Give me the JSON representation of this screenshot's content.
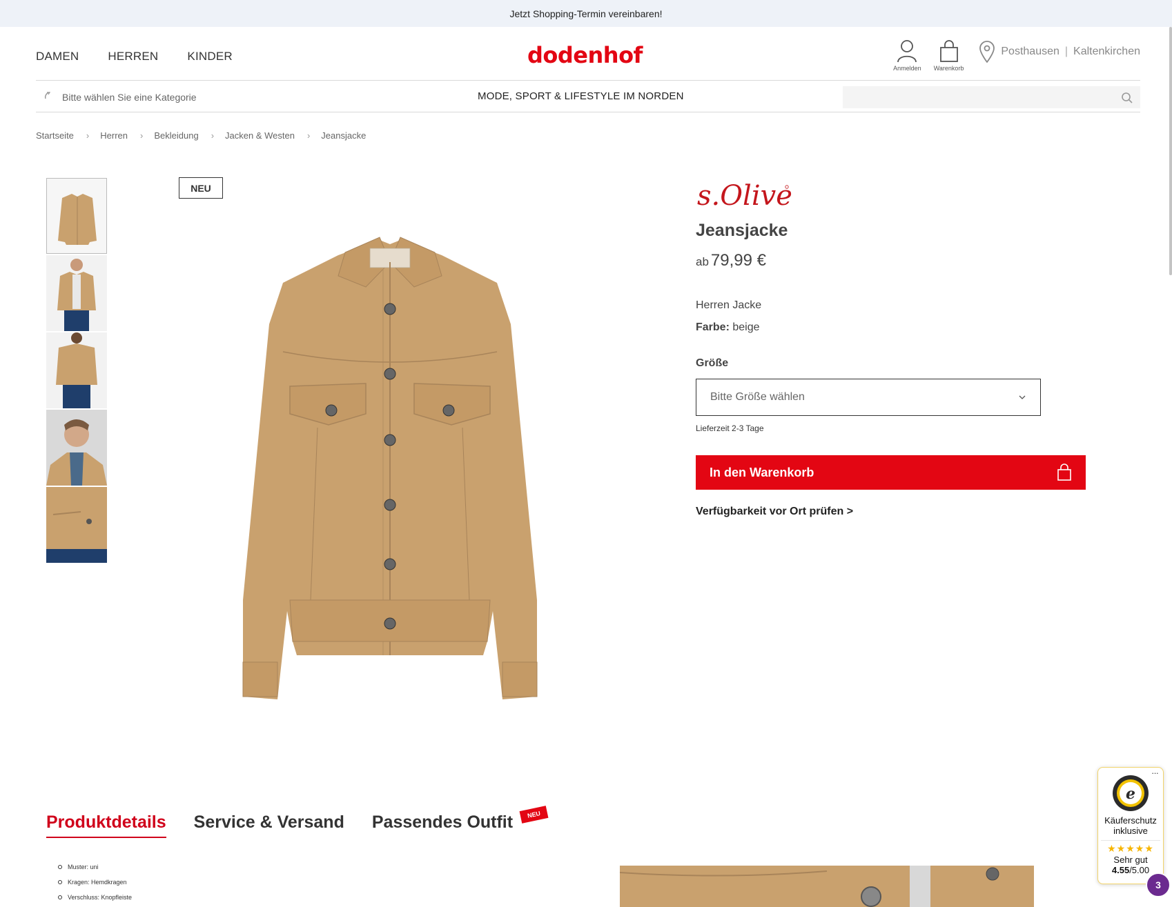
{
  "topbar": {
    "text": "Jetzt Shopping-Termin vereinbaren!"
  },
  "header": {
    "nav": [
      "DAMEN",
      "HERREN",
      "KINDER"
    ],
    "logo": "dodenhof",
    "login_label": "Anmelden",
    "cart_label": "Warenkorb",
    "store_1": "Posthausen",
    "store_2": "Kaltenkirchen"
  },
  "subbar": {
    "category_placeholder": "Bitte wählen Sie eine Kategorie",
    "slogan": "MODE, SPORT & LIFESTYLE IM NORDEN",
    "search_placeholder": ""
  },
  "breadcrumb": [
    "Startseite",
    "Herren",
    "Bekleidung",
    "Jacken & Westen",
    "Jeansjacke"
  ],
  "product": {
    "badge": "NEU",
    "brand": "s.Oliver",
    "name": "Jeansjacke",
    "price_prefix": "ab",
    "price": "79,99 €",
    "description": "Herren Jacke",
    "color_label": "Farbe:",
    "color_value": "beige",
    "size_label": "Größe",
    "size_placeholder": "Bitte Größe wählen",
    "delivery": "Lieferzeit 2-3 Tage",
    "cart_button": "In den Warenkorb",
    "availability": "Verfügbarkeit vor Ort prüfen >"
  },
  "tabs": {
    "details": "Produktdetails",
    "service": "Service & Versand",
    "outfit": "Passendes Outfit",
    "outfit_flag": "NEU"
  },
  "details_list": [
    "Muster: uni",
    "Kragen: Hemdkragen",
    "Verschluss: Knopfleiste"
  ],
  "trusted": {
    "line1": "Käuferschutz",
    "line2": "inklusive",
    "stars": "★★★★★",
    "grade": "Sehr gut",
    "score": "4.55",
    "score_max": "/5.00"
  },
  "notification_count": "3",
  "colors": {
    "brand_red": "#e30613",
    "tab_active": "#d0021b",
    "jacket": "#c9a16e"
  }
}
